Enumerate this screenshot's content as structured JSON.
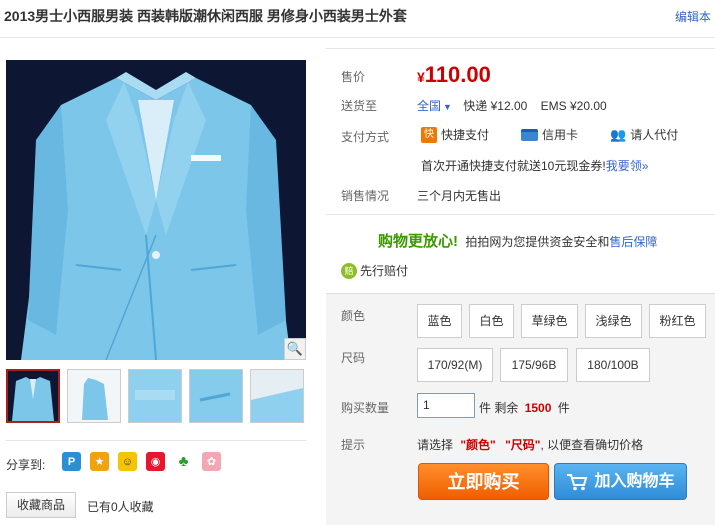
{
  "title": "2013男士小西服男装 西装韩版潮休闲西服 男修身小西装男士外套",
  "edit_link": "编辑本",
  "price": {
    "label": "售价",
    "symbol": "¥",
    "value": "110.00"
  },
  "shipping": {
    "label": "送货至",
    "region": "全国",
    "express": "快递 ¥12.00",
    "ems": "EMS ¥20.00"
  },
  "payment": {
    "label": "支付方式",
    "methods": [
      "快捷支付",
      "信用卡",
      "请人代付"
    ],
    "promo_text": "首次开通快捷支付就送10元现金券!",
    "promo_link": "我要领»"
  },
  "sales": {
    "label": "销售情况",
    "value": "三个月内无售出"
  },
  "assurance": {
    "headline": "购物更放心!",
    "text": "拍拍网为您提供资金安全和",
    "link": "售后保障",
    "advance": "先行赔付"
  },
  "color": {
    "label": "颜色",
    "options": [
      "蓝色",
      "白色",
      "草绿色",
      "浅绿色",
      "粉红色"
    ]
  },
  "size": {
    "label": "尺码",
    "options": [
      "170/92(M)",
      "175/96B",
      "180/100B"
    ]
  },
  "quantity": {
    "label": "购买数量",
    "value": "1",
    "unit_before": "件 剩余",
    "stock": "1500",
    "unit_after": "件"
  },
  "hint": {
    "label": "提示",
    "prefix": "请选择",
    "color_word": "\"颜色\"",
    "size_word": "\"尺码\"",
    "suffix": ", 以便查看确切价格"
  },
  "buttons": {
    "buy": "立即购买",
    "cart": "加入购物车"
  },
  "share": {
    "label": "分享到:"
  },
  "favorite": {
    "button": "收藏商品",
    "count_text": "已有0人收藏"
  },
  "colors": {
    "price_red": "#cc0000",
    "link_blue": "#3366cc",
    "buy_orange": "#f26a00",
    "cart_blue": "#2f8cd8",
    "assure_green": "#3a9a00"
  }
}
